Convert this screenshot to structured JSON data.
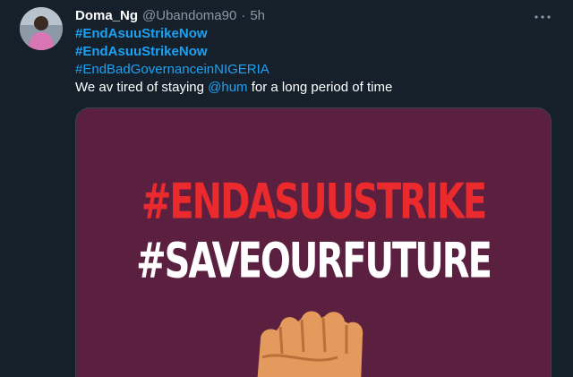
{
  "tweet": {
    "display_name": "Doma_Ng",
    "handle": "@Ubandoma90",
    "separator": "·",
    "time": "5h",
    "more_icon": "more-horizontal-icon",
    "hashtags": [
      {
        "text": "#EndAsuuStrikeNow",
        "bold": true
      },
      {
        "text": "#EndAsuuStrikeNow",
        "bold": true
      },
      {
        "text": "#EndBadGovernanceinNIGERIA",
        "bold": false
      }
    ],
    "body_before": "We av tired of staying ",
    "mention": "@hum",
    "body_after": " for a long period of time"
  },
  "media": {
    "line1": "#ENDASUUSTRIKE",
    "line2": "#SAVEOURFUTURE",
    "background": "#5b1f3f",
    "accent_red": "#ea2a2c",
    "fist_color": "#e39a5c"
  },
  "colors": {
    "background": "#15202b",
    "link": "#1da1f2",
    "muted": "#8899a6"
  }
}
